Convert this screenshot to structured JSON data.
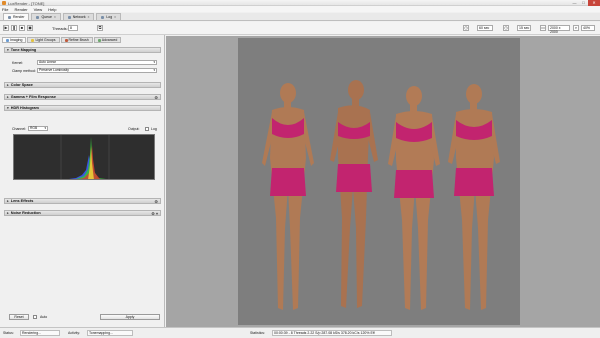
{
  "window": {
    "title": "LuxRender - [TONE]",
    "minimize": "—",
    "maximize": "□",
    "close": "✕"
  },
  "menu": [
    "File",
    "Render",
    "View",
    "Help"
  ],
  "tabs": [
    {
      "label": "Render",
      "close": ""
    },
    {
      "label": "Queue",
      "close": "x"
    },
    {
      "label": "Network",
      "close": "x"
    },
    {
      "label": "Log",
      "close": "x"
    }
  ],
  "toolbar": {
    "threads_label": "Threads:",
    "threads_value": "8",
    "halt_time_value": "60 sec",
    "halt_spp_value": "15 sec",
    "resolution": "2000 x 2000",
    "zoom": "40%"
  },
  "subtabs": [
    "Imaging",
    "Light Groups",
    "Refine Brush",
    "Advanced"
  ],
  "sections": {
    "tone_mapping": "Tone Mapping",
    "color_space": "Color Space",
    "gamma": "Gamma + Film Response",
    "histogram": "HDR Histogram",
    "lens": "Lens Effects",
    "noise": "Noise Reduction"
  },
  "tone_mapping": {
    "kernel_label": "Kernel:",
    "kernel_value": "Auto Linear",
    "clamp_label": "Clamp method:",
    "clamp_value": "Preserve Luminosity"
  },
  "histogram": {
    "channel_label": "Channel:",
    "channel_value": "RGB",
    "output_label": "Output:",
    "log_label": "Log"
  },
  "panel_footer": {
    "reset": "Reset",
    "auto": "Auto",
    "apply": "Apply"
  },
  "status": {
    "status_label": "Status:",
    "status_value": "Rendering...",
    "activity_label": "Activity:",
    "activity_value": "Tonemapping...",
    "statistics_label": "Statistics:",
    "statistics_value": "00:00:39 - 8 Threads 2.22 S/p 287.08 kS/s 378.20 kC/s 120% Eff"
  },
  "colors": {
    "accent_pink": "#c2246f",
    "viewport_bg": "#a5a5a5",
    "render_bg": "#7e7e7e",
    "histogram_bg": "#2e2e2e"
  }
}
